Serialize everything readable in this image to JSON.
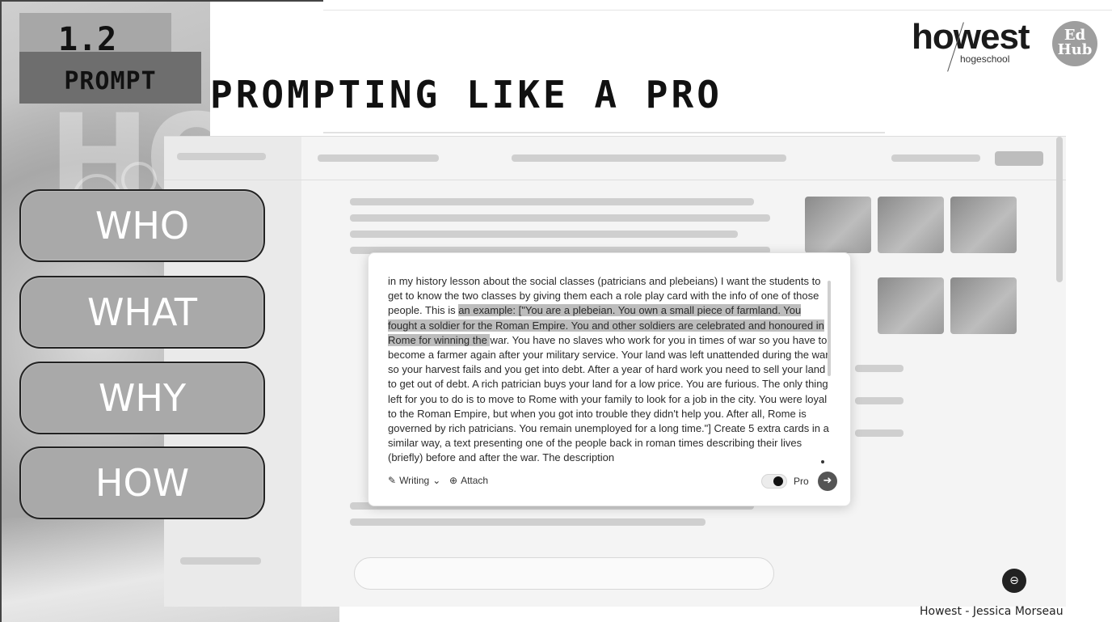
{
  "slide": {
    "section_number": "1.2",
    "section_tag": "PROMPT",
    "title": "PROMPTING LIKE A PRO",
    "credit": "Howest - Jessica Morseau"
  },
  "logos": {
    "howest_word": "howest",
    "howest_sub": "hogeschool",
    "edhub_line1": "Ed",
    "edhub_line2": "Hub"
  },
  "framework": [
    "WHO",
    "WHAT",
    "WHY",
    "HOW"
  ],
  "prompt_box": {
    "text_before_highlight": "in my history lesson about the social classes (patricians and plebeians) I want the students to get to know the two classes by giving them each a role play card with the info of one of those people. This is ",
    "text_highlight": "an example: [\"You are a plebeian. You own a small piece of farmland. You fought a soldier for the Roman Empire. You and other soldiers are celebrated and honoured in Rome for winning the ",
    "text_after_highlight": "war. You have no slaves who work for you in times of war so you have to become a farmer again after your military service. Your land was left unattended during the war so your harvest fails and you get into debt. After a year of hard work you need to sell your land to get out of debt. A rich patrician buys your land for a low price. You are furious. The only thing left for you to do is to move to Rome with your family to look for a job in the city. You were loyal to the Roman Empire, but when you got into trouble they didn't help you. After all, Rome is governed by rich patricians. You remain unemployed for a long time.\"] Create 5 extra cards in a similar way, a text presenting one of the people back in roman times describing their lives (briefly) before and after the war. The description",
    "writing_label": "Writing",
    "attach_label": "Attach",
    "pro_label": "Pro",
    "pro_enabled": true
  },
  "icons": {
    "writing": "pen-icon",
    "writing_chevron": "chevron-down-icon",
    "attach": "plus-circle-icon",
    "send": "arrow-right-icon",
    "float": "chat-bubble-icon"
  }
}
